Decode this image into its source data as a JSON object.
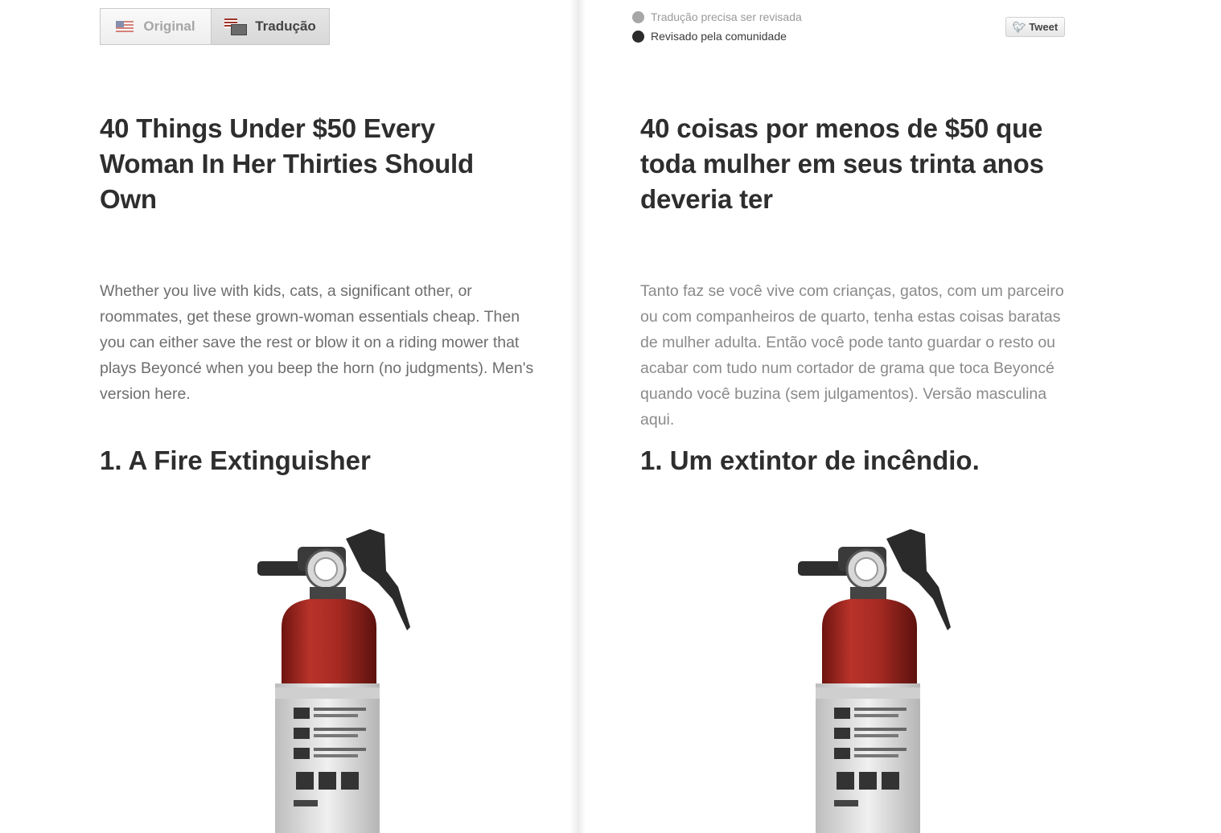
{
  "toggle": {
    "original_label": "Original",
    "translation_label": "Tradução"
  },
  "status": {
    "needs_review": "Tradução precisa ser revisada",
    "community_reviewed": "Revisado pela comunidade"
  },
  "tweet_label": "Tweet",
  "original": {
    "title": "40 Things Under $50 Every Woman In Her Thirties Should Own",
    "intro": "Whether you live with kids, cats, a significant other, or roommates, get these grown-woman essentials cheap.   Then you can either save the rest or blow it on a riding mower that plays Beyoncé when you beep the horn (no judgments).   Men's version here.",
    "item1": "1. A Fire Extinguisher"
  },
  "translation": {
    "title": "40 coisas por menos de $50 que toda mulher em seus trinta anos deveria ter",
    "intro": "Tanto faz se você vive com crianças, gatos, com um parceiro ou com companheiros de quarto, tenha estas coisas baratas de mulher adulta.   Então você pode tanto guardar o resto ou acabar com tudo num cortador de grama que toca Beyoncé quando você buzina (sem julgamentos).   Versão masculina aqui.",
    "item1": "1. Um extintor de incêndio."
  },
  "icons": {
    "flag_original": "us-flag-icon",
    "flag_translation": "translation-flag-icon",
    "tweet": "twitter-bird-icon"
  },
  "colors": {
    "extinguisher_red": "#a52a22",
    "text_dark": "#2e2e2e",
    "text_muted": "#6e6e6e"
  }
}
